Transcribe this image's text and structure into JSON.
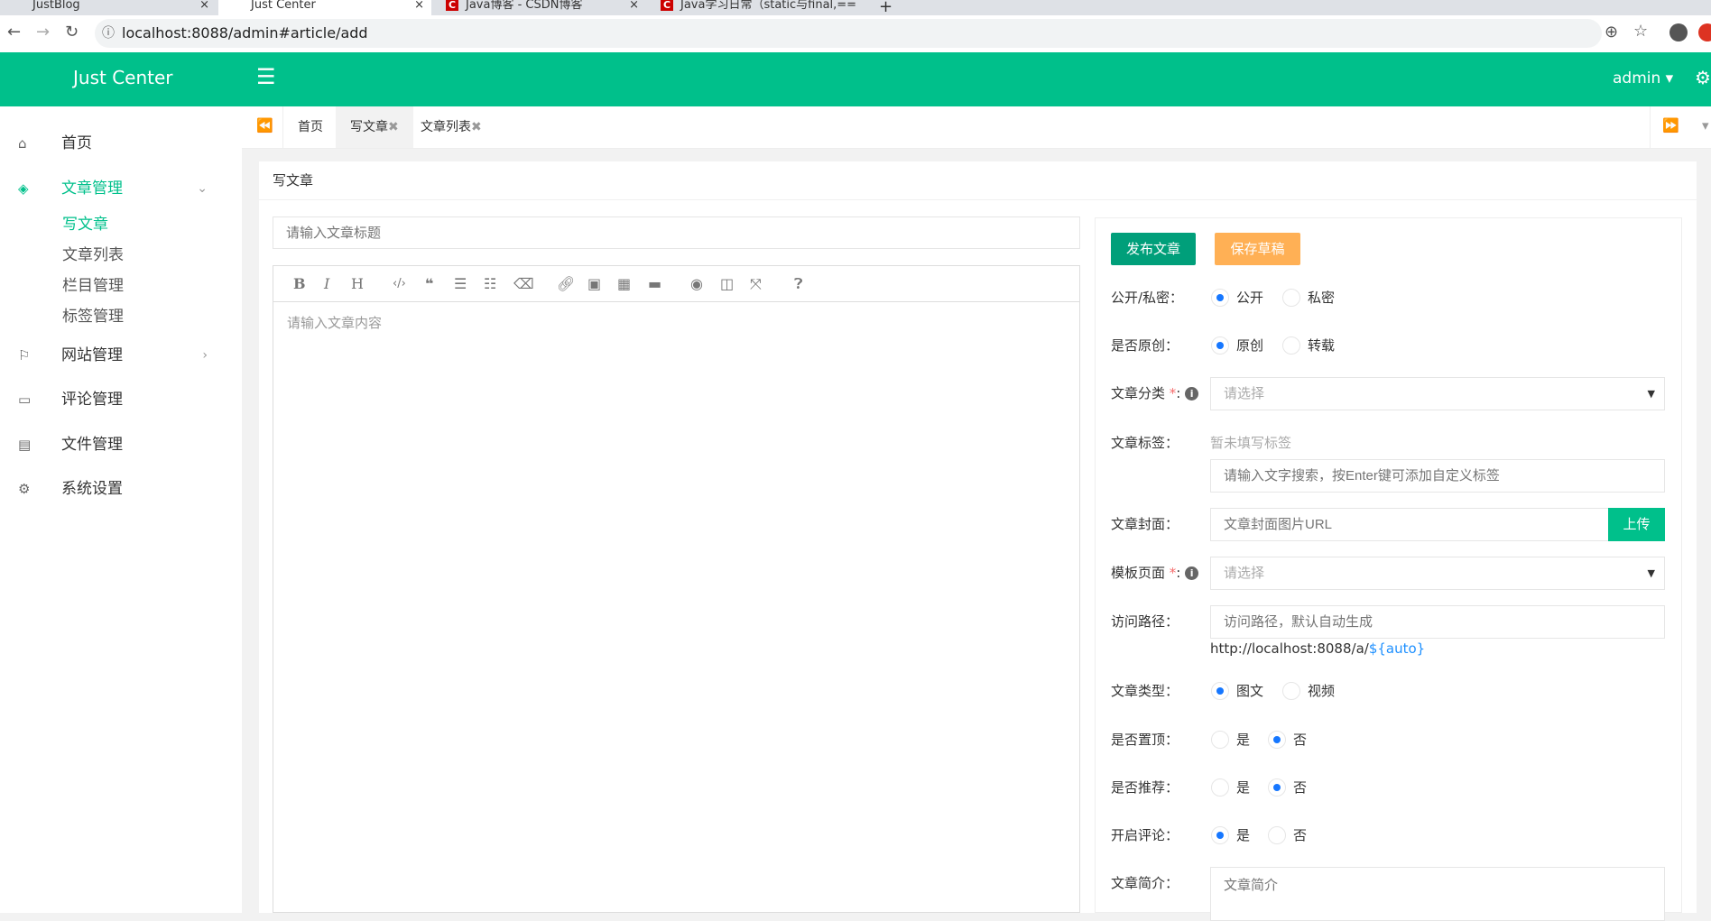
{
  "browser": {
    "tabs": [
      {
        "title": "JustBlog"
      },
      {
        "title": "Just Center"
      },
      {
        "title": "Java博客 - CSDN博客"
      },
      {
        "title": "Java学习日常（static与final,=="
      }
    ],
    "url": "localhost:8088/admin#article/add",
    "close": "×",
    "newtab": "+"
  },
  "header": {
    "brand": "Just Center",
    "user": "admin ▾"
  },
  "sidebar": {
    "items": [
      {
        "label": "首页"
      },
      {
        "label": "文章管理"
      },
      {
        "label": "网站管理"
      },
      {
        "label": "评论管理"
      },
      {
        "label": "文件管理"
      },
      {
        "label": "系统设置"
      }
    ],
    "sub": [
      {
        "label": "写文章"
      },
      {
        "label": "文章列表"
      },
      {
        "label": "栏目管理"
      },
      {
        "label": "标签管理"
      }
    ]
  },
  "pagetabs": [
    {
      "label": "首页"
    },
    {
      "label": "写文章"
    },
    {
      "label": "文章列表"
    }
  ],
  "card": {
    "title": "写文章"
  },
  "editor": {
    "title_placeholder": "请输入文章标题",
    "content_placeholder": "请输入文章内容"
  },
  "form": {
    "publish": "发布文章",
    "draft": "保存草稿",
    "visibility": {
      "label": "公开/私密：",
      "options": [
        "公开",
        "私密"
      ],
      "selected": 0
    },
    "original": {
      "label": "是否原创：",
      "options": [
        "原创",
        "转载"
      ],
      "selected": 0
    },
    "category": {
      "label": "文章分类",
      "req": "*",
      "colon": ":",
      "placeholder": "请选择"
    },
    "tags": {
      "label": "文章标签：",
      "empty": "暂未填写标签",
      "placeholder": "请输入文字搜索，按Enter键可添加自定义标签"
    },
    "cover": {
      "label": "文章封面：",
      "placeholder": "文章封面图片URL",
      "upload": "上传"
    },
    "template": {
      "label": "模板页面",
      "req": "*",
      "colon": ":",
      "placeholder": "请选择"
    },
    "path": {
      "label": "访问路径：",
      "placeholder": "访问路径，默认自动生成",
      "prefix": "http://localhost:8088/a/",
      "var": "${auto}"
    },
    "type": {
      "label": "文章类型：",
      "options": [
        "图文",
        "视频"
      ],
      "selected": 0
    },
    "top": {
      "label": "是否置顶：",
      "options": [
        "是",
        "否"
      ],
      "selected": 1
    },
    "recommend": {
      "label": "是否推荐：",
      "options": [
        "是",
        "否"
      ],
      "selected": 1
    },
    "comment": {
      "label": "开启评论：",
      "options": [
        "是",
        "否"
      ],
      "selected": 0
    },
    "summary": {
      "label": "文章简介：",
      "placeholder": "文章简介"
    }
  }
}
